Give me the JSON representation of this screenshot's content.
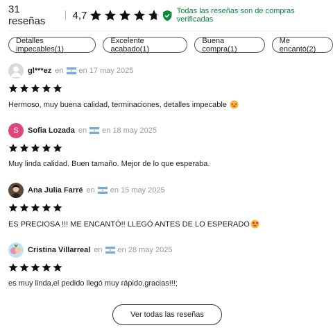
{
  "summary": {
    "count_label": "31 reseñas",
    "rating_value": "4,7",
    "rating": 4.7,
    "star_color": "#111111",
    "verified_text": "Todas las reseñas son de compras verificadas",
    "verified_color": "#0a8a36"
  },
  "chips": [
    {
      "label": "Detalles impecables(1)"
    },
    {
      "label": "Excelente acabado(1)"
    },
    {
      "label": "Buena compra(1)"
    },
    {
      "label": "Me encantó(2)"
    }
  ],
  "reviews": [
    {
      "author": "gl***ez",
      "avatar": "default-user-icon",
      "en": "en",
      "date": "en 17 may 2025",
      "stars": 5,
      "text": "Hermoso, muy buena calidad, terminaciones, detalles impecable",
      "emoji": "star-struck-emoji"
    },
    {
      "author": "Sofia Lozada",
      "avatar_letter": "S",
      "en": "en",
      "date": "en 18 may 2025",
      "stars": 5,
      "text": "Muy linda calidad. Buen tamaño. Mejor de lo que esperaba."
    },
    {
      "author": "Ana Julia Farré",
      "avatar": "photo",
      "en": "en",
      "date": "en 15 may 2025",
      "stars": 5,
      "text": "ES PRECIOSA !!! ME ENCANTÓ!! LLEGÓ ANTES DE LO ESPERADO",
      "emoji": "heart-eyes-emoji"
    },
    {
      "author": "Cristina Villarreal",
      "avatar": "photo",
      "en": "en",
      "date": "en 28 may 2025",
      "stars": 5,
      "text": "es muy linda,el pedido llegó muy rápido,gracias!!!;"
    }
  ],
  "see_all_label": "Ver todas las reseñas",
  "flag": "argentina-flag-icon"
}
